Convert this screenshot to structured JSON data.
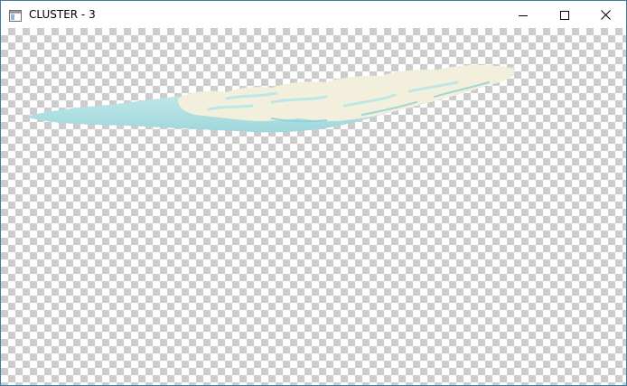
{
  "window": {
    "title": "CLUSTER - 3",
    "icons": {
      "app": "window-app-icon",
      "minimize": "minimize-icon",
      "maximize": "maximize-icon",
      "close": "close-icon"
    }
  },
  "canvas": {
    "background": "transparency-checkerboard",
    "colors": {
      "water": "#bfe6e6",
      "water_dark": "#8fd0d6",
      "land": "#f3efdd",
      "border": "#3c7ea8"
    }
  }
}
